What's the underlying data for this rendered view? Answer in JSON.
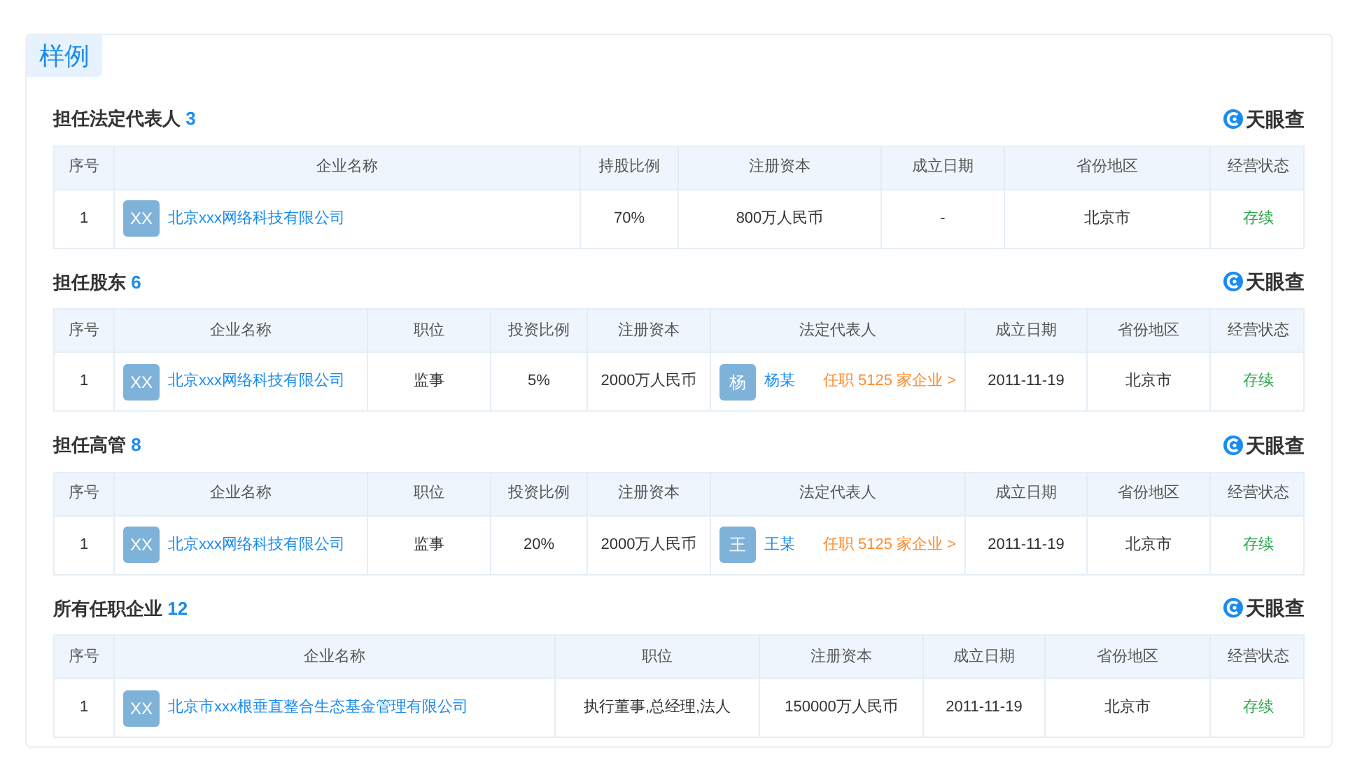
{
  "title": "样例",
  "sections": [
    {
      "heading": "担任法定代表人",
      "count": "3",
      "logo_text": "天眼查",
      "columns": [
        "序号",
        "企业名称",
        "持股比例",
        "注册资本",
        "成立日期",
        "省份地区",
        "经营状态"
      ],
      "rows": [
        [
          {
            "kind": "text",
            "text": "1"
          },
          {
            "kind": "company",
            "avatar": "XX",
            "text": "北京xxx网络科技有限公司"
          },
          {
            "kind": "text",
            "text": "70%"
          },
          {
            "kind": "text",
            "text": "800万人民币"
          },
          {
            "kind": "text",
            "text": "-"
          },
          {
            "kind": "text",
            "text": "北京市"
          },
          {
            "kind": "status",
            "text": "存续"
          }
        ]
      ]
    },
    {
      "heading": "担任股东",
      "count": "6",
      "logo_text": "天眼查",
      "columns": [
        "序号",
        "企业名称",
        "职位",
        "投资比例",
        "注册资本",
        "法定代表人",
        "成立日期",
        "省份地区",
        "经营状态"
      ],
      "rows": [
        [
          {
            "kind": "text",
            "text": "1"
          },
          {
            "kind": "company",
            "avatar": "XX",
            "text": "北京xxx网络科技有限公司"
          },
          {
            "kind": "text",
            "text": "监事"
          },
          {
            "kind": "text",
            "text": "5%"
          },
          {
            "kind": "text",
            "text": "2000万人民币"
          },
          {
            "kind": "person",
            "avatar": "杨",
            "text": "杨某",
            "link": "任职 5125 家企业 >"
          },
          {
            "kind": "text",
            "text": "2011-11-19"
          },
          {
            "kind": "text",
            "text": "北京市"
          },
          {
            "kind": "status",
            "text": "存续"
          }
        ]
      ]
    },
    {
      "heading": "担任高管",
      "count": "8",
      "logo_text": "天眼查",
      "columns": [
        "序号",
        "企业名称",
        "职位",
        "投资比例",
        "注册资本",
        "法定代表人",
        "成立日期",
        "省份地区",
        "经营状态"
      ],
      "rows": [
        [
          {
            "kind": "text",
            "text": "1"
          },
          {
            "kind": "company",
            "avatar": "XX",
            "text": "北京xxx网络科技有限公司"
          },
          {
            "kind": "text",
            "text": "监事"
          },
          {
            "kind": "text",
            "text": "20%"
          },
          {
            "kind": "text",
            "text": "2000万人民币"
          },
          {
            "kind": "person",
            "avatar": "王",
            "text": "王某",
            "link": "任职 5125 家企业 >"
          },
          {
            "kind": "text",
            "text": "2011-11-19"
          },
          {
            "kind": "text",
            "text": "北京市"
          },
          {
            "kind": "status",
            "text": "存续"
          }
        ]
      ]
    },
    {
      "heading": "所有任职企业",
      "count": "12",
      "logo_text": "天眼查",
      "columns": [
        "序号",
        "企业名称",
        "职位",
        "注册资本",
        "成立日期",
        "省份地区",
        "经营状态"
      ],
      "rows": [
        [
          {
            "kind": "text",
            "text": "1"
          },
          {
            "kind": "company",
            "avatar": "XX",
            "text": "北京市xxx根垂直整合生态基金管理有限公司"
          },
          {
            "kind": "text",
            "text": "执行董事,总经理,法人"
          },
          {
            "kind": "text",
            "text": "150000万人民币"
          },
          {
            "kind": "text",
            "text": "2011-11-19"
          },
          {
            "kind": "text",
            "text": "北京市"
          },
          {
            "kind": "status",
            "text": "存续"
          }
        ]
      ]
    }
  ]
}
